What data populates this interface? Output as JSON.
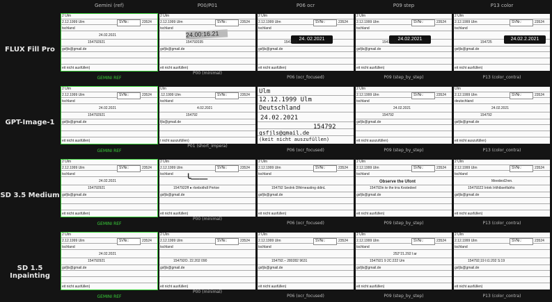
{
  "columns": [
    "Gemini (ref)",
    "P00/P01",
    "P06 ocr",
    "P09 step",
    "P13 color"
  ],
  "rows": [
    {
      "label": "FLUX Fill Pro",
      "captions": [
        "GEMINI REF",
        "P00 (minimal)",
        "P06 (ocr_focused)",
        "P09 (step_by_step)",
        "P13 (color_contra)"
      ],
      "cells": [
        {
          "l1": "2 Ulm",
          "l2": "2.12.1999 Ulm",
          "svnr": "SVNr.:",
          "num": "23524",
          "l3": "tschland",
          "date": "24.02.2021",
          "id": "154792921",
          "mail": "gsfjls@gmail.de",
          "note": "eit nicht ausfüllen)"
        },
        {
          "l1": "2 Ulm",
          "l2": "2.12.1999 Ulm",
          "svnr": "SVNr.:",
          "num": "23524",
          "l3": "tschland",
          "date": "24.00:16.21",
          "id": "154792035",
          "mail": "gsfjls@gmail.de",
          "note": "eit nicht ausfüllen)"
        },
        {
          "l1": "2 Ulm",
          "l2": "2.12.1999 Ulm",
          "svnr": "SVNr.:",
          "num": "23524",
          "l3": "tschland",
          "date": "24. 02.2021",
          "id": "1547929",
          "mail": "gsfjls@gmail.de",
          "note": "eit nicht ausfüllen)"
        },
        {
          "l1": "2 Ulm",
          "l2": "2.12.1999 Ulm",
          "svnr": "SVNr.:",
          "num": "23524",
          "l3": "tschland",
          "date": "24.02.2021",
          "id": "15479290",
          "mail": "gsfjls@gmail.de",
          "note": "eit nicht ausfüllen)"
        },
        {
          "l1": "2 Ulm",
          "l2": "2.12.1999 Ulm",
          "svnr": "SVNr.:",
          "num": "23524",
          "l3": "tschland",
          "date": "24.02.2.2021",
          "id": "154725",
          "mail": "gsfjls@gmail.de",
          "note": "eit nicht ausfüllen)"
        }
      ]
    },
    {
      "label": "GPT-Image-1",
      "captions": [
        "GEMINI REF",
        "P01 (short_impera)",
        "P06 (ocr_focused)",
        "P09 (step_by_step)",
        "P13 (color_contra)"
      ],
      "cells": [
        {
          "l1": "2 Ulm",
          "l2": "2.12.1999 Ulm",
          "svnr": "SVNr.:",
          "num": "23524",
          "l3": "tschland",
          "date": "24.02.2021",
          "id": "154792921",
          "mail": "gsfjls@gmail.de",
          "note": "eit nicht ausfüllen)"
        },
        {
          "l1": "Ulm",
          "l2": ".12.1999 Ulm",
          "svnr": "SVNr.:",
          "num": "23524",
          "l3": "tschland",
          "date": "4.02.2021",
          "id": "154792",
          "mail": "fjls@gmail.de",
          "note": "t nicht auszufüllen)"
        },
        {
          "l1": "Ulm",
          "l2": "12.12.1999 Ulm",
          "l3": "Deutschland",
          "date": "24.02.2021",
          "id": "154792",
          "mail": "gsfjls@gmail.de",
          "note": "(keit nicht auszufüllen)"
        },
        {
          "l1": "2 Ulm",
          "l2": "2.12.1999 Ulm",
          "svnr": "SVNr.:",
          "num": "23524",
          "l3": "tschland",
          "date": "24.02.2021",
          "id": "154792",
          "mail": "gsfjls@gmail.de",
          "note": "eit nicht auszufüllen)"
        },
        {
          "l1": "Ulm",
          "l2": "2.12.1999 Ulm",
          "svnr": "SVNr.:",
          "num": "23524",
          "l3": "deutschland",
          "date": "24.02.2021",
          "id": "154792",
          "mail": "gsfjls@gmail.de",
          "note": "eit nicht auszufüllen)"
        }
      ]
    },
    {
      "label": "SD 3.5 Medium",
      "captions": [
        "GEMINI REF",
        "P00 (minimal)",
        "P06 (ocr_focused)",
        "P09 (step_by_step)",
        "P13 (color_contra)"
      ],
      "cells": [
        {
          "l1": "2 Ulm",
          "l2": "2.12.1999 Ulm",
          "svnr": "SVNr.:",
          "num": "23524",
          "l3": "tschland",
          "date": "24.02.2021",
          "id": "154792921",
          "mail": "gsfjls@gmail.de",
          "note": "eit nicht ausfüllen)"
        },
        {
          "l1": "2 Ulm",
          "l2": "2.12.1999 Ulm",
          "svnr": "SVNr.:",
          "num": "23524",
          "l3": "tschland",
          "date": "",
          "id": "1547922ff ● rlonbothdl Pnrtoe",
          "mail": "gsfjls@gmail.de",
          "note": "eit nicht ausfüllen)"
        },
        {
          "l1": "2 Ulm",
          "l2": "2.12.1999 Ulm",
          "svnr": "SVNr.:",
          "num": "23524",
          "l3": "tschland",
          "date": "",
          "id": "154792 Seolnk Dlhlrneasting ddinL",
          "mail": "gsfjls@gmail.de",
          "note": "eit nicht ausfüllen)"
        },
        {
          "l1": "2 Ulm",
          "l2": "2.12.1999 Ulm",
          "svnr": "SVNr.:",
          "num": "23524",
          "l3": "tschland",
          "date": "Observe the Ufont",
          "id": "154792in te the trra Kestedeel",
          "mail": "gsfjls@gmail.de",
          "note": "eit nicht ausfüllen)"
        },
        {
          "l1": "2 Ulm",
          "l2": "2.12.1999 Ulm",
          "svnr": "SVNr.:",
          "num": "23524",
          "l3": "tschland",
          "date": "Meedeol2ren.",
          "id": "154792Z2 Intnk Irtthibsetfalrhs",
          "mail": "gsfjls@gmail.de",
          "note": "eit nicht ausfüllen)"
        }
      ]
    },
    {
      "label": "SD 1.5 Inpainting",
      "captions": [
        "GEMINI REF",
        "P00 (minimal)",
        "P06 (ocr_focused)",
        "P09 (step_by_step)",
        "P13 (color_contra)"
      ],
      "cells": [
        {
          "l1": "2 Ulm",
          "l2": "2.12.1999 Ulm",
          "svnr": "SVNr.:",
          "num": "23524",
          "l3": "tschland",
          "date": "24.02.2021",
          "id": "154792921",
          "mail": "gsfjls@gmail.de",
          "note": "eit nicht ausfüllen)"
        },
        {
          "l1": "2 Ulm",
          "l2": "2.12.1999 Ulm",
          "svnr": "SVNr.:",
          "num": "23524",
          "l3": "tschland",
          "date": "",
          "id": "154792O.   22.202 090",
          "mail": "gsfjls@gmail.de",
          "note": "eit nicht ausfüllen)"
        },
        {
          "l1": "2 Ulm",
          "l2": "2.12.1999 Ulm",
          "svnr": "SVNr.:",
          "num": "23524",
          "l3": "tschland",
          "date": "",
          "id": "154792.– 280282 9631",
          "mail": "gsfjls@gmail.de",
          "note": "eit nicht ausfüllen)"
        },
        {
          "l1": "2 Ulm",
          "l2": "2.12.1999 Ulm",
          "svnr": "SVNr.:",
          "num": "23524",
          "l3": "tschland",
          "date": "252°21.292 l:ar",
          "id": "1547921 9 2C:222 Um",
          "mail": "gsfjls@gmail.de",
          "note": "eit nicht ausfüllen)"
        },
        {
          "l1": "2 Ulm",
          "l2": "2.12.1999 Ulm",
          "svnr": "SVNr.:",
          "num": "23524",
          "l3": "tschland",
          "date": "",
          "id": "154792;19 l:t1:202 S:19",
          "mail": "gsfjls@gmail.de",
          "note": "eit nicht ausfüllen)"
        }
      ]
    }
  ]
}
